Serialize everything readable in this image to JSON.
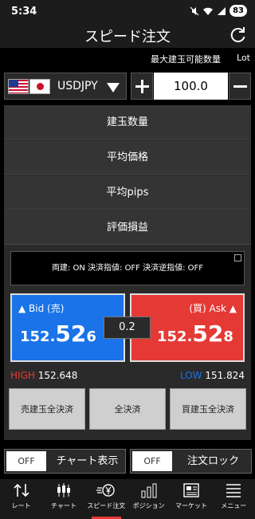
{
  "status": {
    "time": "5:34",
    "battery": "83"
  },
  "title": "スピード注文",
  "max_qty_label": "最大建玉可能数量",
  "unit": "Lot",
  "pair": {
    "symbol": "USDJPY"
  },
  "quantity": "100.0",
  "rows": [
    "建玉数量",
    "平均価格",
    "平均pips",
    "評価損益"
  ],
  "settings_text": "両建: ON 決済指値: OFF 決済逆指値: OFF",
  "bid": {
    "label": "Bid (売)",
    "price_a": "152.",
    "price_b": "52",
    "price_c": "6"
  },
  "ask": {
    "label": "(買) Ask",
    "price_a": "152.",
    "price_b": "52",
    "price_c": "8"
  },
  "spread": "0.2",
  "high": {
    "label": "HIGH",
    "value": "152.648"
  },
  "low": {
    "label": "LOW",
    "value": "151.824"
  },
  "actions": [
    "売建玉全決済",
    "全決済",
    "買建玉全決済"
  ],
  "toggles": [
    {
      "state": "OFF",
      "label": "チャート表示"
    },
    {
      "state": "OFF",
      "label": "注文ロック"
    }
  ],
  "nav": [
    "レート",
    "チャート",
    "スピード注文",
    "ポジション",
    "マーケット",
    "メニュー"
  ],
  "colors": {
    "bid": "#1a73e8",
    "ask": "#e53935",
    "nav_active": "#e53935"
  }
}
